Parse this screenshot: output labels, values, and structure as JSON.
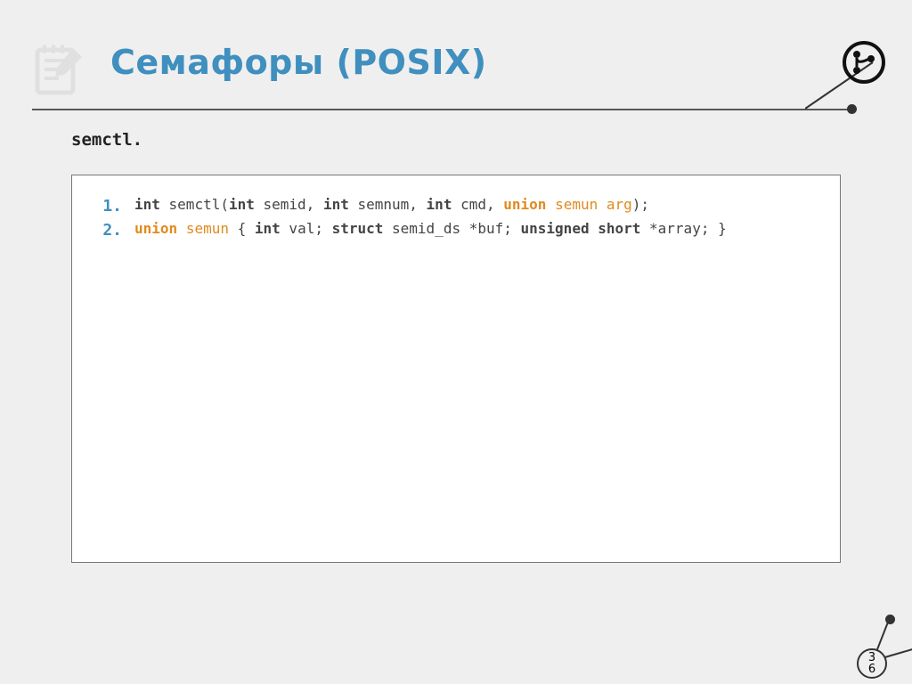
{
  "header": {
    "title": "Семафоры (POSIX)"
  },
  "subheading": "semctl.",
  "code": {
    "lines": [
      {
        "num": "1.",
        "tokens": [
          {
            "t": "int",
            "c": "kw"
          },
          {
            "t": " semctl("
          },
          {
            "t": "int",
            "c": "kw"
          },
          {
            "t": " semid, "
          },
          {
            "t": "int",
            "c": "kw"
          },
          {
            "t": " semnum, "
          },
          {
            "t": "int",
            "c": "kw"
          },
          {
            "t": " cmd, "
          },
          {
            "t": "union",
            "c": "kwo"
          },
          {
            "t": " "
          },
          {
            "t": "semun",
            "c": "ido"
          },
          {
            "t": " "
          },
          {
            "t": "arg",
            "c": "ido"
          },
          {
            "t": ");"
          }
        ]
      },
      {
        "num": "2.",
        "tokens": [
          {
            "t": "union",
            "c": "kwo"
          },
          {
            "t": " "
          },
          {
            "t": "semun",
            "c": "ido"
          },
          {
            "t": " { "
          },
          {
            "t": "int",
            "c": "kw"
          },
          {
            "t": " val; "
          },
          {
            "t": "struct",
            "c": "kw"
          },
          {
            "t": " semid_ds *buf; "
          },
          {
            "t": "unsigned",
            "c": "kw"
          },
          {
            "t": " "
          },
          {
            "t": "short",
            "c": "kw"
          },
          {
            "t": " *array; }"
          }
        ]
      }
    ]
  },
  "page_number": {
    "top": "3",
    "bottom": "6"
  },
  "colors": {
    "accent": "#3f8fbf",
    "keyword_orange": "#e08a1e"
  }
}
